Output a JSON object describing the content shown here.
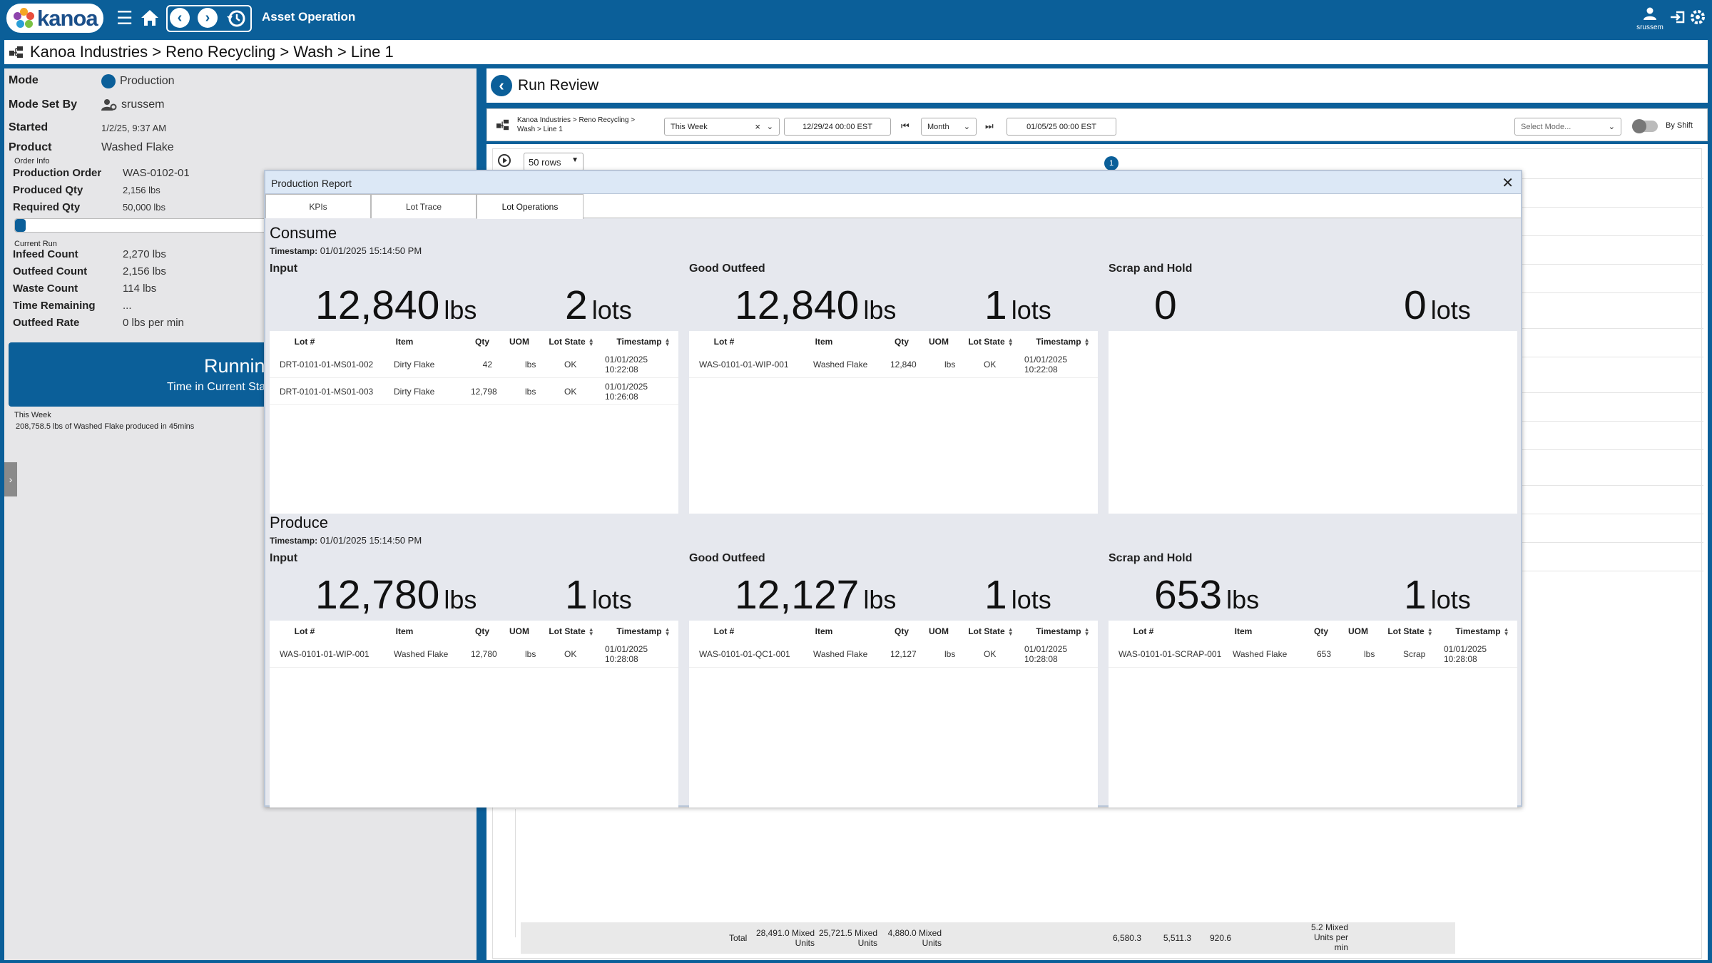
{
  "app": {
    "title": "Asset Operation",
    "logo_text": "kanoa",
    "user": "srussem",
    "colors": {
      "primary": "#0b5f99",
      "panel": "#e6e6e8"
    }
  },
  "breadcrumb": "Kanoa Industries > Reno Recycling > Wash > Line 1",
  "left": {
    "mode_label": "Mode",
    "mode_value": "Production",
    "modeset_label": "Mode Set By",
    "modeset_value": "srussem",
    "started_label": "Started",
    "started_value": "1/2/25, 9:37 AM",
    "product_label": "Product",
    "product_value": "Washed Flake",
    "order_info_title": "Order Info",
    "order": [
      {
        "label": "Production Order",
        "value": "WAS-0102-01"
      },
      {
        "label": "Produced Qty",
        "value": "2,156 lbs"
      },
      {
        "label": "Required Qty",
        "value": "50,000 lbs"
      }
    ],
    "progress_fraction": 0.043,
    "current_run_title": "Current Run",
    "run": [
      {
        "label": "Infeed Count",
        "value": "2,270 lbs"
      },
      {
        "label": "Outfeed Count",
        "value": "2,156 lbs"
      },
      {
        "label": "Waste Count",
        "value": "114 lbs"
      },
      {
        "label": "Time Remaining",
        "value": "..."
      },
      {
        "label": "Outfeed Rate",
        "value": "0 lbs per min"
      }
    ],
    "state_text": "Running",
    "state_sub": "Time in Current State",
    "week_title": "This Week",
    "week_summary": "208,758.5 lbs of Washed Flake produced in 45mins"
  },
  "run_review": {
    "title": "Run Review",
    "filter_crumb_1": "Kanoa Industries > Reno Recycling >",
    "filter_crumb_2": "Wash > Line 1",
    "range_select": "This Week",
    "start_date": "12/29/24 00:00 EST",
    "period": "Month",
    "end_date": "01/05/25 00:00 EST",
    "mode_placeholder": "Select Mode...",
    "by_shift_label": "By Shift",
    "rows_select": "50 rows",
    "page": "1",
    "totals": {
      "label": "Total",
      "c1": "28,491.0 Mixed\nUnits",
      "c2": "25,721.5 Mixed\nUnits",
      "c3": "4,880.0 Mixed\nUnits",
      "c4": "6,580.3",
      "c5": "5,511.3",
      "c6": "920.6",
      "c7": "5.2 Mixed\nUnits per\nmin"
    }
  },
  "modal": {
    "title": "Production Report",
    "tabs": [
      "KPIs",
      "Lot Trace",
      "Lot Operations"
    ],
    "columns_headers": [
      "Lot #",
      "Item",
      "Qty",
      "UOM",
      "Lot State",
      "Timestamp"
    ],
    "consume": {
      "title": "Consume",
      "timestamp_label": "Timestamp:",
      "timestamp": "01/01/2025 15:14:50 PM",
      "input": {
        "title": "Input",
        "qty": "12,840",
        "qty_unit": "lbs",
        "lots": "2",
        "lots_unit": "lots",
        "rows": [
          {
            "lot": "DRT-0101-01-MS01-002",
            "item": "Dirty Flake",
            "qty": "42",
            "uom": "lbs",
            "state": "OK",
            "ts1": "01/01/2025",
            "ts2": "10:22:08"
          },
          {
            "lot": "DRT-0101-01-MS01-003",
            "item": "Dirty Flake",
            "qty": "12,798",
            "uom": "lbs",
            "state": "OK",
            "ts1": "01/01/2025",
            "ts2": "10:26:08"
          }
        ]
      },
      "good": {
        "title": "Good Outfeed",
        "qty": "12,840",
        "qty_unit": "lbs",
        "lots": "1",
        "lots_unit": "lots",
        "rows": [
          {
            "lot": "WAS-0101-01-WIP-001",
            "item": "Washed Flake",
            "qty": "12,840",
            "uom": "lbs",
            "state": "OK",
            "ts1": "01/01/2025",
            "ts2": "10:22:08"
          }
        ]
      },
      "scrap": {
        "title": "Scrap and Hold",
        "qty": "0",
        "lots": "0",
        "lots_unit": "lots",
        "rows": []
      }
    },
    "produce": {
      "title": "Produce",
      "timestamp_label": "Timestamp:",
      "timestamp": "01/01/2025 15:14:50 PM",
      "input": {
        "title": "Input",
        "qty": "12,780",
        "qty_unit": "lbs",
        "lots": "1",
        "lots_unit": "lots",
        "rows": [
          {
            "lot": "WAS-0101-01-WIP-001",
            "item": "Washed Flake",
            "qty": "12,780",
            "uom": "lbs",
            "state": "OK",
            "ts1": "01/01/2025",
            "ts2": "10:28:08"
          }
        ]
      },
      "good": {
        "title": "Good Outfeed",
        "qty": "12,127",
        "qty_unit": "lbs",
        "lots": "1",
        "lots_unit": "lots",
        "rows": [
          {
            "lot": "WAS-0101-01-QC1-001",
            "item": "Washed Flake",
            "qty": "12,127",
            "uom": "lbs",
            "state": "OK",
            "ts1": "01/01/2025",
            "ts2": "10:28:08"
          }
        ]
      },
      "scrap": {
        "title": "Scrap and Hold",
        "qty": "653",
        "qty_unit": "lbs",
        "lots": "1",
        "lots_unit": "lots",
        "rows": [
          {
            "lot": "WAS-0101-01-SCRAP-001",
            "item": "Washed Flake",
            "qty": "653",
            "uom": "lbs",
            "state": "Scrap",
            "ts1": "01/01/2025",
            "ts2": "10:28:08"
          }
        ]
      }
    }
  }
}
